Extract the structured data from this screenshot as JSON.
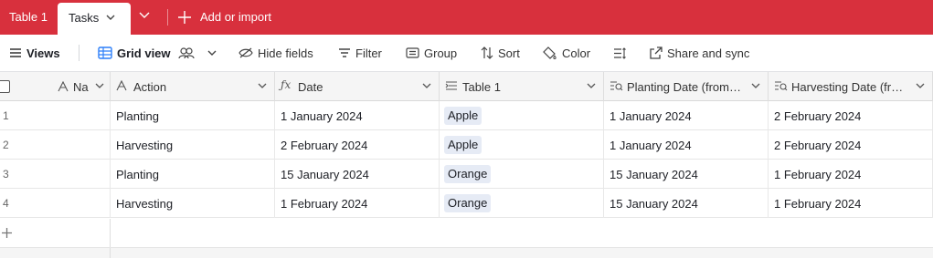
{
  "tabs": {
    "table1_label": "Table 1",
    "active_label": "Tasks",
    "add_import_label": "Add or import"
  },
  "toolbar": {
    "views_label": "Views",
    "view_name": "Grid view",
    "hide_fields_label": "Hide fields",
    "filter_label": "Filter",
    "group_label": "Group",
    "sort_label": "Sort",
    "color_label": "Color",
    "share_label": "Share and sync"
  },
  "grid": {
    "columns": [
      {
        "label": "Na",
        "icon": "text-field-icon"
      },
      {
        "label": "Action",
        "icon": "text-field-icon"
      },
      {
        "label": "Date",
        "icon": "formula-icon"
      },
      {
        "label": "Table 1",
        "icon": "linked-record-icon"
      },
      {
        "label": "Planting Date (from…",
        "icon": "lookup-icon"
      },
      {
        "label": "Harvesting Date (fr…",
        "icon": "lookup-icon"
      }
    ],
    "rows": [
      {
        "num": "1",
        "name": "",
        "action": "Planting",
        "date": "1 January 2024",
        "table1": "Apple",
        "planting": "1 January 2024",
        "harvesting": "2 February 2024"
      },
      {
        "num": "2",
        "name": "",
        "action": "Harvesting",
        "date": "2 February 2024",
        "table1": "Apple",
        "planting": "1 January 2024",
        "harvesting": "2 February 2024"
      },
      {
        "num": "3",
        "name": "",
        "action": "Planting",
        "date": "15 January 2024",
        "table1": "Orange",
        "planting": "15 January 2024",
        "harvesting": "1 February 2024"
      },
      {
        "num": "4",
        "name": "",
        "action": "Harvesting",
        "date": "1 February 2024",
        "table1": "Orange",
        "planting": "15 January 2024",
        "harvesting": "1 February 2024"
      }
    ]
  },
  "colors": {
    "tabbar_bg": "#d8303d",
    "header_bg": "#f5f5f5",
    "chip_bg": "#e6ebf5",
    "grid_view_icon": "#2d7ff9"
  }
}
